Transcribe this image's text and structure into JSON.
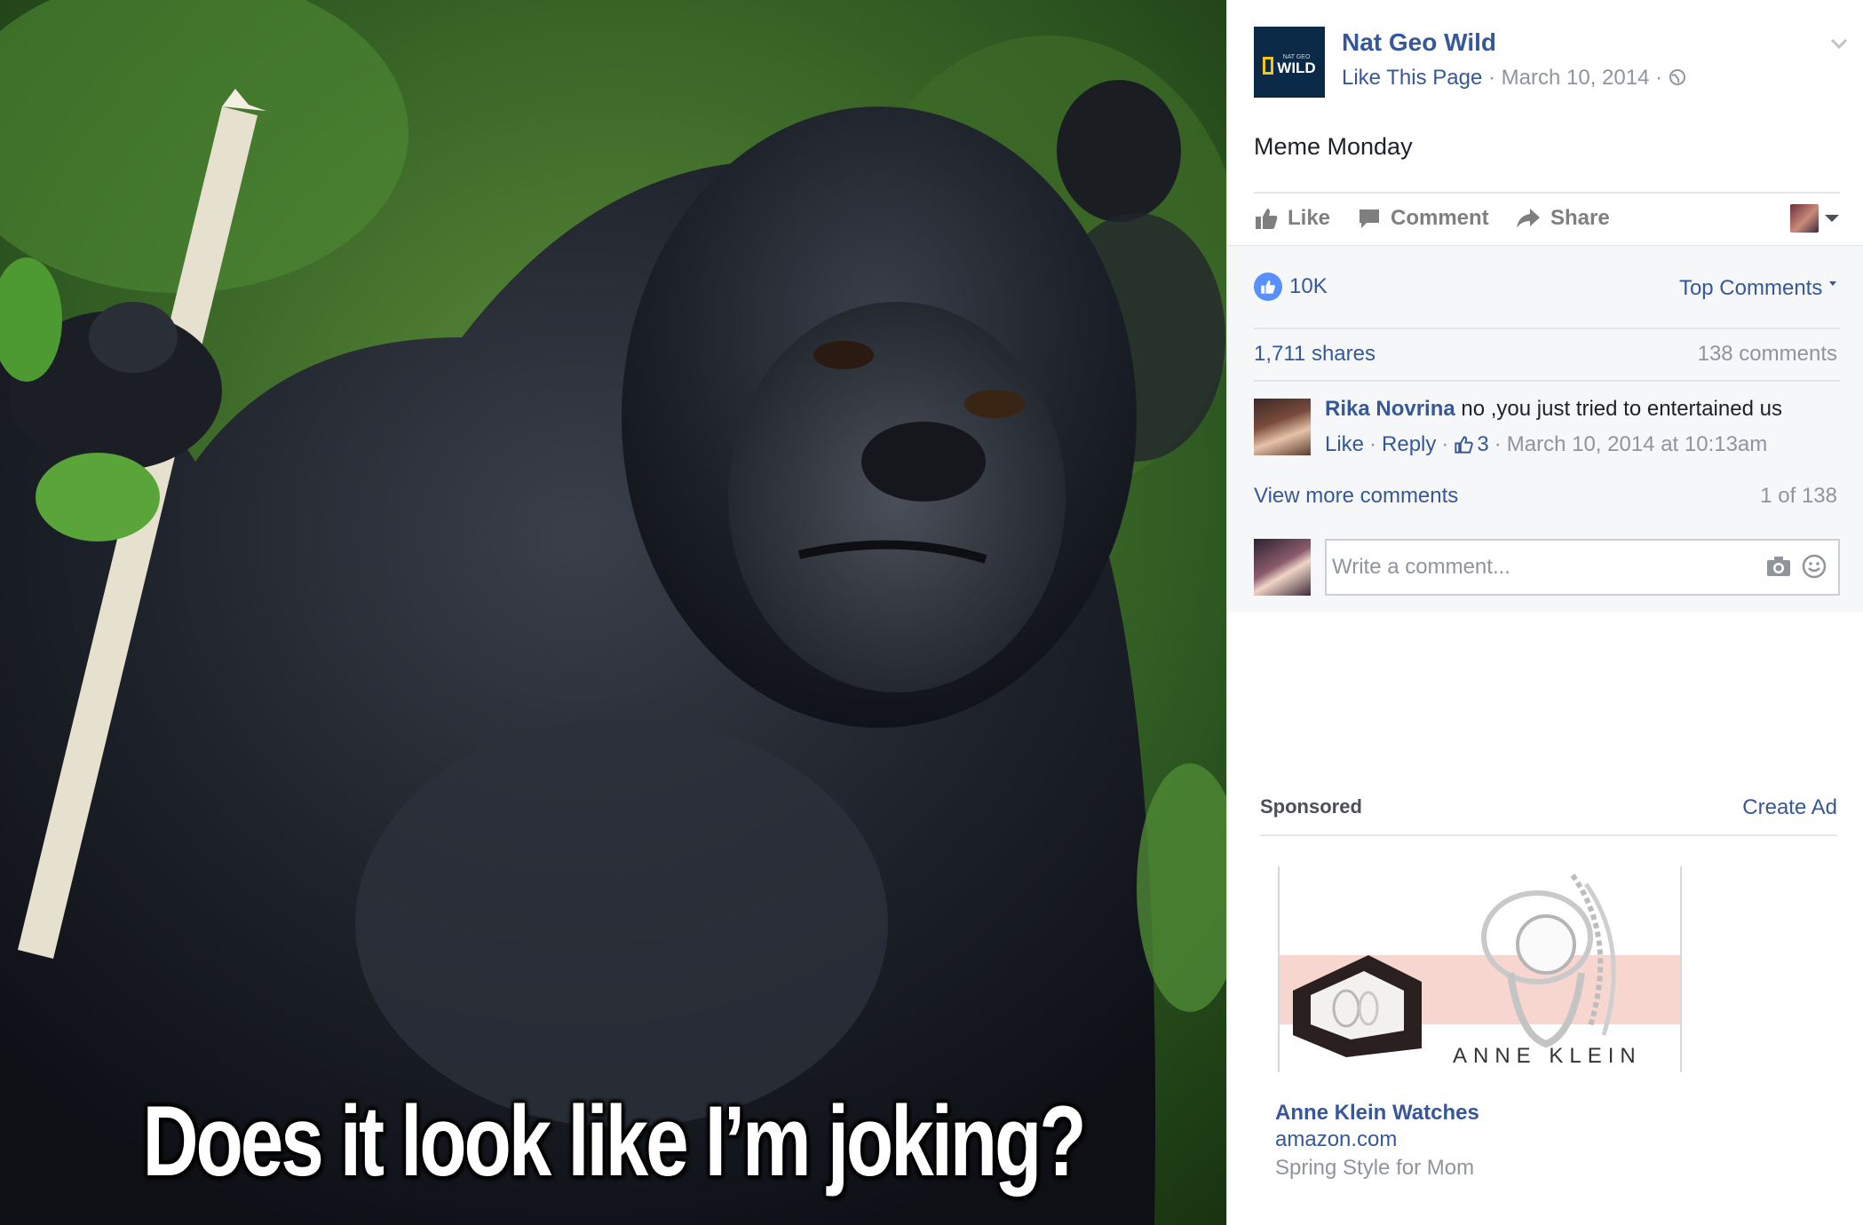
{
  "photo": {
    "caption": "Does it look like I’m joking?"
  },
  "post": {
    "page_name": "Nat Geo Wild",
    "logo_small": "NAT GEO",
    "logo_big": "WILD",
    "like_page": "Like This Page",
    "date": "March 10, 2014",
    "sep": "·",
    "privacy_icon": "globe-icon",
    "text": "Meme Monday"
  },
  "actions": {
    "like": "Like",
    "comment": "Comment",
    "share": "Share"
  },
  "feedback": {
    "reaction_count": "10K",
    "top_comments": "Top Comments",
    "shares": "1,711 shares",
    "comments_count": "138 comments",
    "comment": {
      "author": "Rika Novrina",
      "text": "no ,you just tried to entertained us",
      "like": "Like",
      "reply": "Reply",
      "likes": "3",
      "timestamp": "March 10, 2014 at 10:13am"
    },
    "view_more": "View more comments",
    "page_of": "1 of 138",
    "composer_placeholder": "Write a comment..."
  },
  "sponsored": {
    "label": "Sponsored",
    "create_ad": "Create Ad",
    "ad_brand": "ANNE KLEIN",
    "ad_title": "Anne Klein Watches",
    "ad_domain": "amazon.com",
    "ad_desc": "Spring Style for Mom"
  },
  "colors": {
    "link": "#365899",
    "muted": "#90949c",
    "like_blue": "#5890ff",
    "ad_pink": "#f7d6cf"
  }
}
